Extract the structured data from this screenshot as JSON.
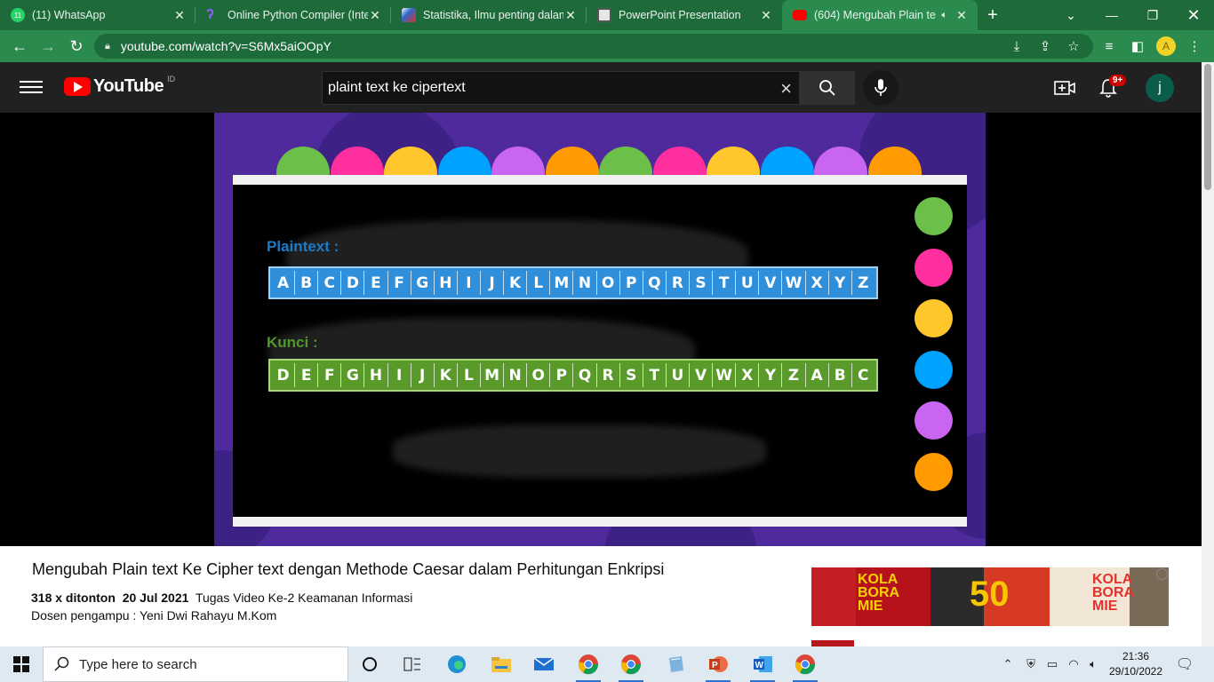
{
  "browser": {
    "tabs": [
      {
        "title": "(11) WhatsApp",
        "favicon_color": "#25d366",
        "favicon_text": "11",
        "active": false
      },
      {
        "title": "Online Python Compiler (Inte",
        "favicon_color": "#6b3fe3",
        "active": false
      },
      {
        "title": "Statistika, Ilmu penting dalam",
        "favicon_color": "#2f66c7",
        "active": false
      },
      {
        "title": "PowerPoint Presentation",
        "favicon_color": "#cfcfcf",
        "active": false
      },
      {
        "title": "(604) Mengubah Plain te",
        "favicon_color": "#ff0000",
        "active": true
      }
    ],
    "new_tab_label": "+",
    "url": "youtube.com/watch?v=S6Mx5aiOOpY",
    "profile_initial": "A"
  },
  "youtube": {
    "logo_text": "YouTube",
    "country_code": "ID",
    "search_query": "plaint text ke cipertext",
    "notification_count": "9+",
    "avatar_initial": "j"
  },
  "slide": {
    "plaintext_label": "Plaintext :",
    "kunci_label": "Kunci :",
    "plaintext_letters": [
      "A",
      "B",
      "C",
      "D",
      "E",
      "F",
      "G",
      "H",
      "I",
      "J",
      "K",
      "L",
      "M",
      "N",
      "O",
      "P",
      "Q",
      "R",
      "S",
      "T",
      "U",
      "V",
      "W",
      "X",
      "Y",
      "Z"
    ],
    "kunci_letters": [
      "D",
      "E",
      "F",
      "G",
      "H",
      "I",
      "J",
      "K",
      "L",
      "M",
      "N",
      "O",
      "P",
      "Q",
      "R",
      "S",
      "T",
      "U",
      "V",
      "W",
      "X",
      "Y",
      "Z",
      "A",
      "B",
      "C"
    ],
    "colors": {
      "background": "#4e2a9c",
      "plaintext_row": "#2f8fdb",
      "kunci_row": "#5a9a2b",
      "plaintext_label": "#1a7cc9",
      "kunci_label": "#4e9a28"
    },
    "top_ball_colors": [
      "#6cc04a",
      "#ff2fa0",
      "#ffc72c",
      "#00a2ff",
      "#c965f0",
      "#ff9a00",
      "#6cc04a",
      "#ff2fa0",
      "#ffc72c",
      "#00a2ff",
      "#c965f0",
      "#ff9a00"
    ],
    "side_ball_colors": [
      "#6cc04a",
      "#ff2fa0",
      "#ffc72c",
      "#00a2ff",
      "#c965f0",
      "#ff9a00"
    ]
  },
  "video_info": {
    "title": "Mengubah Plain text Ke Cipher text dengan Methode Caesar dalam Perhitungan Enkripsi",
    "views": "318 x ditonton",
    "date": "20 Jul 2021",
    "description": "Tugas Video Ke-2 Keamanan Informasi",
    "lecturer": "Dosen pengampu : Yeni Dwi Rahayu M.Kom",
    "ad_panels": [
      {
        "text": "KOLA\nBORA\nMIE"
      },
      {
        "text": "50"
      },
      {
        "text": "KOLA\nBORA\nMIE"
      }
    ]
  },
  "taskbar": {
    "search_placeholder": "Type here to search",
    "time": "21:36",
    "date": "29/10/2022"
  }
}
